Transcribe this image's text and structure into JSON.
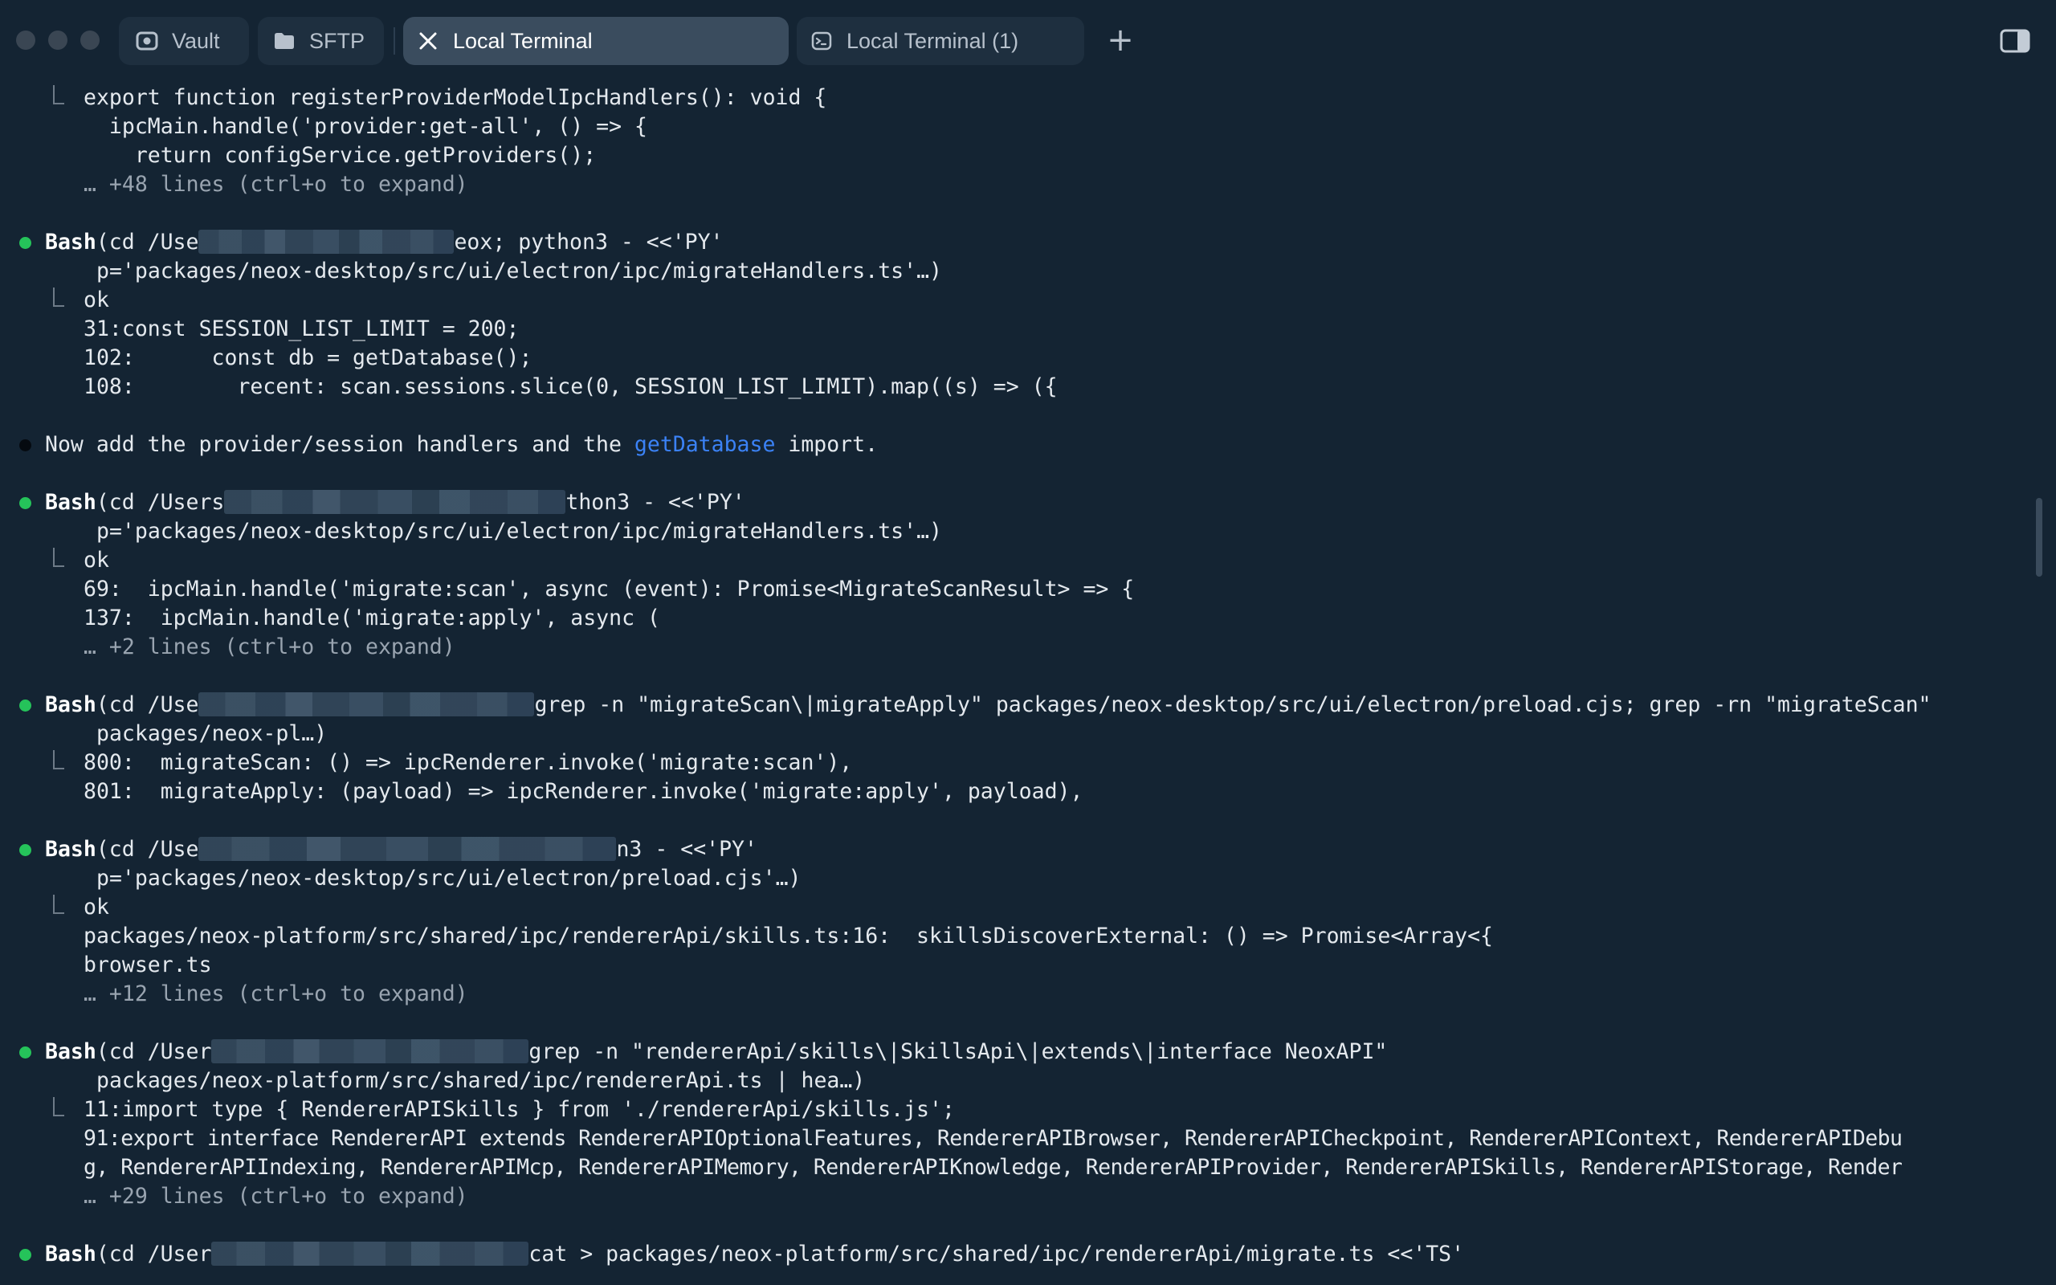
{
  "window": {
    "tabs": [
      {
        "label": "Vault",
        "icon": "vault-icon"
      },
      {
        "label": "SFTP",
        "icon": "folder-icon"
      },
      {
        "label": "Local Terminal",
        "icon": "close-icon"
      },
      {
        "label": "Local Terminal (1)",
        "icon": "terminal-icon"
      }
    ],
    "active_tab": "Local Terminal"
  },
  "colors": {
    "background": "#142433",
    "active_tab": "#3a4c5e",
    "success_bullet": "#25c35a",
    "link": "#3b82f6"
  },
  "terminal": {
    "lines": [
      {
        "prefix": "",
        "text": "export function registerProviderModelIpcHandlers(): void {"
      },
      {
        "text": "  ipcMain.handle('provider:get-all', () => {"
      },
      {
        "text": "    return configService.getProviders();"
      },
      {
        "text": "… +48 lines (ctrl+o to expand)"
      },
      {
        "tool": "Bash",
        "pre": "(cd /Use",
        "post": "eox; python3 - <<'PY'"
      },
      {
        "text": "p='packages/neox-desktop/src/ui/electron/ipc/migrateHandlers.ts'…)"
      },
      {
        "text": "ok"
      },
      {
        "text": "31:const SESSION_LIST_LIMIT = 200;"
      },
      {
        "text": "102:      const db = getDatabase();"
      },
      {
        "text": "108:        recent: scan.sessions.slice(0, SESSION_LIST_LIMIT).map((s) => ({"
      },
      {
        "pre": "Now add the provider/session handlers and the ",
        "link": "getDatabase",
        "post": " import."
      },
      {
        "tool": "Bash",
        "pre": "(cd /Users",
        "post": "thon3 - <<'PY'"
      },
      {
        "text": "p='packages/neox-desktop/src/ui/electron/ipc/migrateHandlers.ts'…)"
      },
      {
        "text": "ok"
      },
      {
        "text": "69:  ipcMain.handle('migrate:scan', async (event): Promise<MigrateScanResult> => {"
      },
      {
        "text": "137:  ipcMain.handle('migrate:apply', async ("
      },
      {
        "text": "… +2 lines (ctrl+o to expand)"
      },
      {
        "tool": "Bash",
        "pre": "(cd /Use",
        "post": "grep -n \"migrateScan\\|migrateApply\" packages/neox-desktop/src/ui/electron/preload.cjs; grep -rn \"migrateScan\""
      },
      {
        "text": "packages/neox-pl…)"
      },
      {
        "text": "800:  migrateScan: () => ipcRenderer.invoke('migrate:scan'),"
      },
      {
        "text": "801:  migrateApply: (payload) => ipcRenderer.invoke('migrate:apply', payload),"
      },
      {
        "tool": "Bash",
        "pre": "(cd /Use",
        "post": "n3 - <<'PY'"
      },
      {
        "text": "p='packages/neox-desktop/src/ui/electron/preload.cjs'…)"
      },
      {
        "text": "ok"
      },
      {
        "text": "packages/neox-platform/src/shared/ipc/rendererApi/skills.ts:16:  skillsDiscoverExternal: () => Promise<Array<{"
      },
      {
        "text": "browser.ts"
      },
      {
        "text": "… +12 lines (ctrl+o to expand)"
      },
      {
        "tool": "Bash",
        "pre": "(cd /User",
        "post": "grep -n \"rendererApi/skills\\|SkillsApi\\|extends\\|interface NeoxAPI\""
      },
      {
        "text": "packages/neox-platform/src/shared/ipc/rendererApi.ts | hea…)"
      },
      {
        "text": "11:import type { RendererAPISkills } from './rendererApi/skills.js';"
      },
      {
        "text": "91:export interface RendererAPI extends RendererAPIOptionalFeatures, RendererAPIBrowser, RendererAPICheckpoint, RendererAPIContext, RendererAPIDebu"
      },
      {
        "text": "g, RendererAPIIndexing, RendererAPIMcp, RendererAPIMemory, RendererAPIKnowledge, RendererAPIProvider, RendererAPISkills, RendererAPIStorage, Render"
      },
      {
        "text": "… +29 lines (ctrl+o to expand)"
      },
      {
        "tool": "Bash",
        "pre": "(cd /User",
        "post": "cat > packages/neox-platform/src/shared/ipc/rendererApi/migrate.ts <<'TS'"
      }
    ]
  }
}
